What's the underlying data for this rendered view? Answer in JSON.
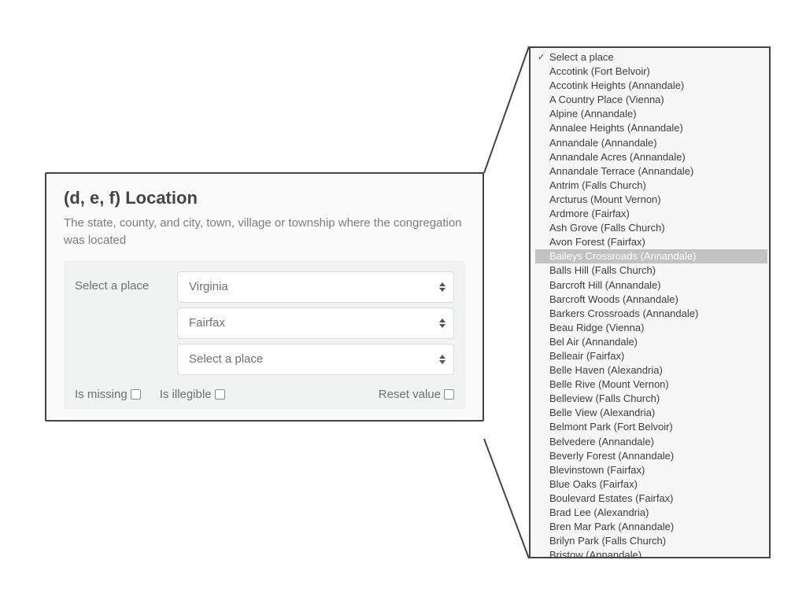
{
  "card": {
    "title": "(d, e, f) Location",
    "description": "The state, county, and city, town, village or township where the congregation was located",
    "field_label": "Select a place",
    "selects": {
      "state": "Virginia",
      "county": "Fairfax",
      "place": "Select a place"
    },
    "footer": {
      "is_missing": "Is missing",
      "is_illegible": "Is illegible",
      "reset_value": "Reset value"
    }
  },
  "dropdown": {
    "checked_index": 0,
    "highlight_index": 14,
    "items": [
      "Select a place",
      "Accotink (Fort Belvoir)",
      "Accotink Heights (Annandale)",
      "A Country Place (Vienna)",
      "Alpine (Annandale)",
      "Annalee Heights (Annandale)",
      "Annandale (Annandale)",
      "Annandale Acres (Annandale)",
      "Annandale Terrace (Annandale)",
      "Antrim (Falls Church)",
      "Arcturus (Mount Vernon)",
      "Ardmore (Fairfax)",
      "Ash Grove (Falls Church)",
      "Avon Forest (Fairfax)",
      "Baileys Crossroads (Annandale)",
      "Balls Hill (Falls Church)",
      "Barcroft Hill (Annandale)",
      "Barcroft Woods (Annandale)",
      "Barkers Crossroads (Annandale)",
      "Beau Ridge (Vienna)",
      "Bel Air (Annandale)",
      "Belleair (Fairfax)",
      "Belle Haven (Alexandria)",
      "Belle Rive (Mount Vernon)",
      "Belleview (Falls Church)",
      "Belle View (Alexandria)",
      "Belmont Park (Fort Belvoir)",
      "Belvedere (Annandale)",
      "Beverly Forest (Annandale)",
      "Blevinstown (Fairfax)",
      "Blue Oaks (Fairfax)",
      "Boulevard Estates (Fairfax)",
      "Brad Lee (Alexandria)",
      "Bren Mar Park (Annandale)",
      "Brilyn Park (Falls Church)",
      "Bristow (Annandale)"
    ]
  }
}
